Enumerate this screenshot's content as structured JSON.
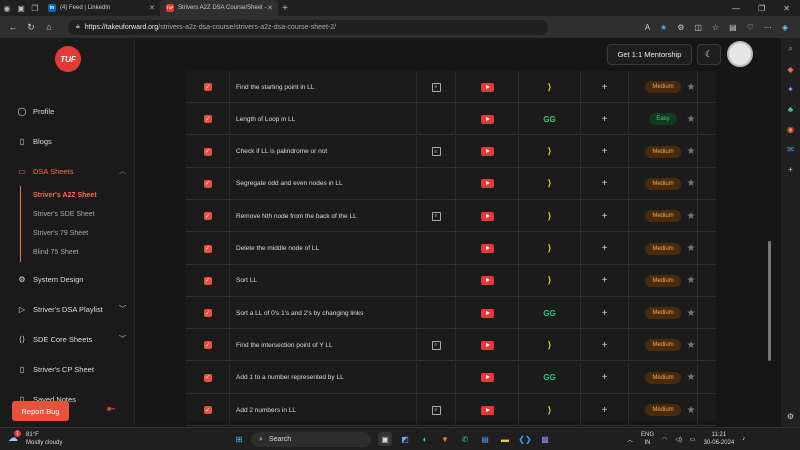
{
  "browser": {
    "tabs": [
      {
        "label": "(4) Feed | LinkedIn",
        "favicon": "in"
      },
      {
        "label": "Strivers A2Z DSA Course/Sheet -",
        "favicon": "TUF"
      }
    ],
    "url_domain": "https://takeuforward.org",
    "url_path": "/strivers-a2z-dsa-course/strivers-a2z-dsa-course-sheet-2/"
  },
  "site": {
    "logo": "TUF",
    "mentorship_label": "Get 1:1 Mentorship",
    "report_bug_label": "Report Bug"
  },
  "sidebar": {
    "profile": "Profile",
    "blogs": "Blogs",
    "dsa_sheets": "DSA Sheets",
    "sheets": [
      "Striver's A2Z Sheet",
      "Striver's SDE Sheet",
      "Striver's 79 Sheet",
      "Blind 75 Sheet"
    ],
    "system_design": "System Design",
    "dsa_playlist": "Striver's DSA Playlist",
    "sde_core": "SDE Core Sheets",
    "cp_sheet": "Striver's CP Sheet",
    "saved_notes": "Saved Notes"
  },
  "problems": [
    {
      "name": "Find the starting point in LL",
      "difficulty": "Medium",
      "article": true,
      "practice": "code"
    },
    {
      "name": "Length of Loop in LL",
      "difficulty": "Easy",
      "article": false,
      "practice": "gfg"
    },
    {
      "name": "Check if LL is palindrome or not",
      "difficulty": "Medium",
      "article": true,
      "practice": "code"
    },
    {
      "name": "Segregate odd and even nodes in LL",
      "difficulty": "Medium",
      "article": false,
      "practice": "code"
    },
    {
      "name": "Remove Nth node from the back of the LL",
      "difficulty": "Medium",
      "article": true,
      "practice": "code"
    },
    {
      "name": "Delete the middle node of LL",
      "difficulty": "Medium",
      "article": false,
      "practice": "code"
    },
    {
      "name": "Sort LL",
      "difficulty": "Medium",
      "article": false,
      "practice": "code"
    },
    {
      "name": "Sort a LL of 0's 1's and 2's by changing links",
      "difficulty": "Medium",
      "article": false,
      "practice": "gfg"
    },
    {
      "name": "Find the intersection point of Y LL",
      "difficulty": "Medium",
      "article": true,
      "practice": "code"
    },
    {
      "name": "Add 1 to a number represented by LL",
      "difficulty": "Medium",
      "article": false,
      "practice": "gfg"
    },
    {
      "name": "Add 2 numbers in LL",
      "difficulty": "Medium",
      "article": true,
      "practice": "code"
    }
  ],
  "taskbar": {
    "weather_temp": "81°F",
    "weather_desc": "Mostly cloudy",
    "search_placeholder": "Search",
    "lang_top": "ENG",
    "lang_bottom": "IN",
    "time": "11:21",
    "date": "30-06-2024"
  },
  "colors": {
    "accent": "#e8513a",
    "medium": "#f5a65b",
    "easy": "#3ccf72"
  }
}
